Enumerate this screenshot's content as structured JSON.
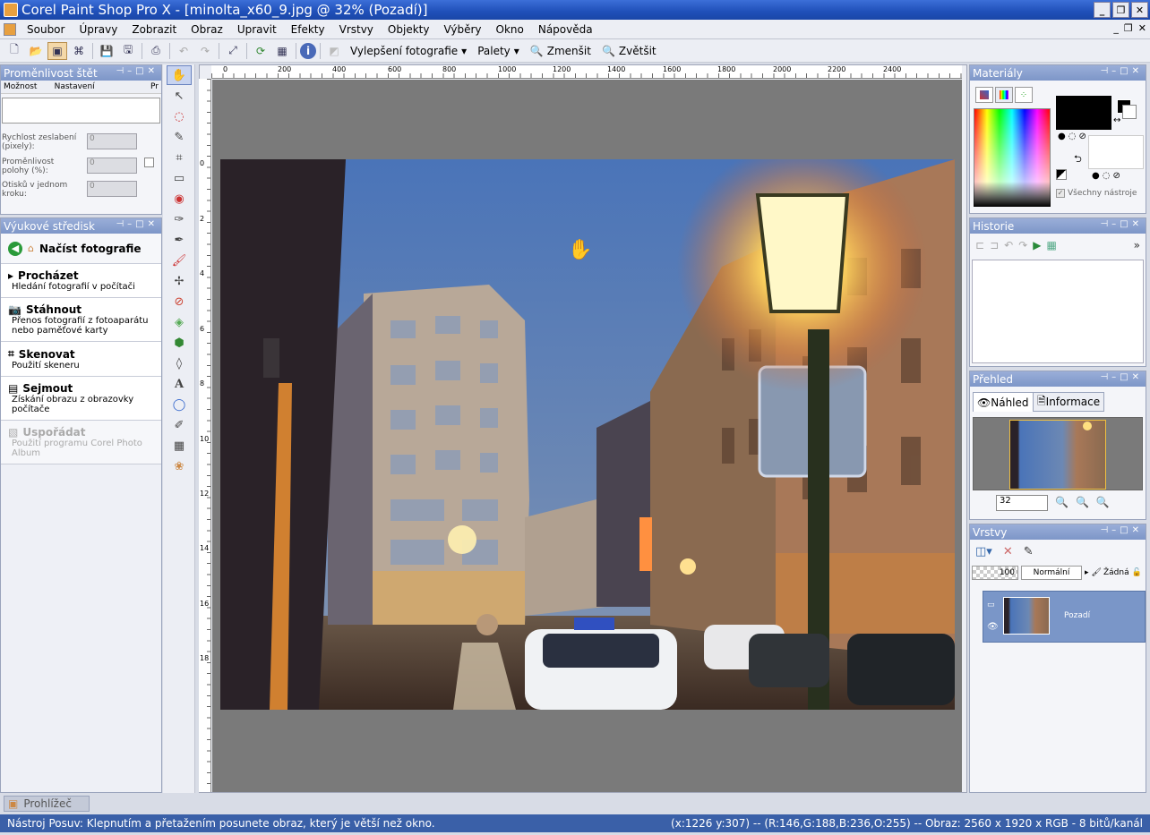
{
  "window": {
    "title": "Corel Paint Shop Pro X - [minolta_x60_9.jpg @  32% (Pozadí)]"
  },
  "menu": [
    "Soubor",
    "Úpravy",
    "Zobrazit",
    "Obraz",
    "Upravit",
    "Efekty",
    "Vrstvy",
    "Objekty",
    "Výběry",
    "Okno",
    "Nápověda"
  ],
  "toolbar": {
    "enhance": "Vylepšení fotografie",
    "palettes": "Palety",
    "zoom_out": "Zmenšit",
    "zoom_in": "Zvětšit"
  },
  "brush_panel": {
    "title": "Proměnlivost štět",
    "col1": "Možnost",
    "col2": "Nastavení",
    "col3": "Pr",
    "opt1": "Rychlost zeslabení (pixely):",
    "opt2": "Proměnlivost polohy (%):",
    "opt3": "Otisků v jednom kroku:",
    "v1": "0",
    "v2": "0",
    "v3": "0"
  },
  "learning": {
    "title": "Výukové středisk",
    "header": "Načíst fotografie",
    "items": [
      {
        "title": "Procházet",
        "desc": "Hledání fotografií v počítači"
      },
      {
        "title": "Stáhnout",
        "desc": "Přenos fotografií z fotoaparátu nebo paměťové karty"
      },
      {
        "title": "Skenovat",
        "desc": "Použití skeneru"
      },
      {
        "title": "Sejmout",
        "desc": "Získání obrazu z obrazovky počítače"
      },
      {
        "title": "Uspořádat",
        "desc": "Použití programu Corel Photo Album"
      }
    ]
  },
  "ruler": {
    "top": [
      "0",
      "200",
      "400",
      "600",
      "800",
      "1000",
      "1200",
      "1400",
      "1600",
      "1800",
      "2000",
      "2200",
      "2400"
    ],
    "left": [
      "0",
      "2",
      "4",
      "6",
      "8",
      "10",
      "12",
      "14",
      "16",
      "18"
    ]
  },
  "materials": {
    "title": "Materiály",
    "all_tools": "Všechny nástroje",
    "fg": "#000000",
    "bg": "#ffffff"
  },
  "history": {
    "title": "Historie"
  },
  "overview": {
    "title": "Přehled",
    "tab1": "Náhled",
    "tab2": "Informace",
    "zoom": "32"
  },
  "layers": {
    "title": "Vrstvy",
    "opacity": "100",
    "blend": "Normální",
    "mask": "Žádná",
    "layer_name": "Pozadí"
  },
  "bottom_tab": "Prohlížeč",
  "status": {
    "left": "Nástroj Posuv: Klepnutím a přetažením posunete obraz, který je větší než okno.",
    "right": "(x:1226 y:307) -- (R:146,G:188,B:236,O:255) -- Obraz:  2560 x 1920 x RGB - 8 bitů/kanál"
  }
}
